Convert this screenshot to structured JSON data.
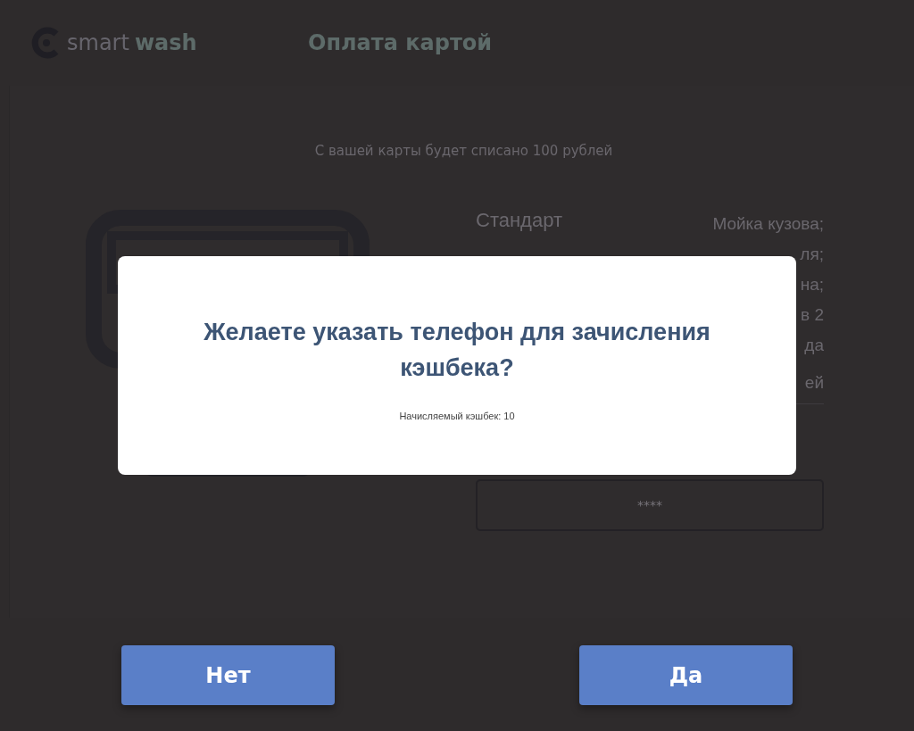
{
  "header": {
    "logo": {
      "part1": "smart",
      "part2": "wash"
    },
    "title": "Оплата картой"
  },
  "payment": {
    "message": "С вашей карты будет списано 100 рублей",
    "tariff": {
      "name": "Стандарт",
      "services": [
        "Мойка кузова;",
        "ля;",
        "на;",
        "в 2",
        "да",
        "ей"
      ]
    },
    "card_field": {
      "value": "****"
    }
  },
  "dialog": {
    "title": "Желаете указать телефон для зачисления кэшбека?",
    "note": "Начисляемый кэшбек: 10"
  },
  "buttons": [
    {
      "label": "Нет"
    },
    {
      "label": "Да"
    }
  ]
}
